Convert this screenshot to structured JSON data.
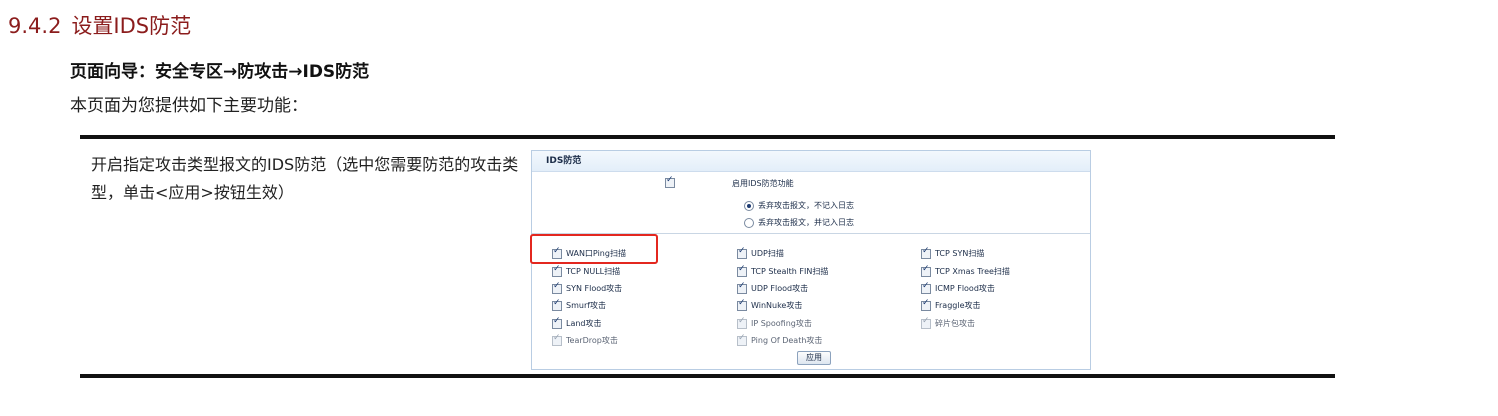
{
  "section": {
    "number": "9.4.2",
    "title": "设置IDS防范"
  },
  "nav_path": "页面向导：安全专区→防攻击→IDS防范",
  "intro": "本页面为您提供如下主要功能：",
  "description": "开启指定攻击类型报文的IDS防范（选中您需要防范的攻击类型，单击<应用>按钮生效）",
  "panel": {
    "title": "IDS防范",
    "enable_label": "启用IDS防范功能",
    "radio_drop_no_log": "丢弃攻击报文，不记入日志",
    "radio_drop_log": "丢弃攻击报文，并记入日志",
    "apply_label": "应用",
    "items": [
      "WAN口Ping扫描",
      "UDP扫描",
      "TCP SYN扫描",
      "TCP NULL扫描",
      "TCP Stealth FIN扫描",
      "TCP Xmas Tree扫描",
      "SYN Flood攻击",
      "UDP Flood攻击",
      "ICMP Flood攻击",
      "Smurf攻击",
      "WinNuke攻击",
      "Fraggle攻击",
      "Land攻击",
      "IP Spoofing攻击",
      "碎片包攻击",
      "TearDrop攻击",
      "Ping Of Death攻击"
    ]
  }
}
